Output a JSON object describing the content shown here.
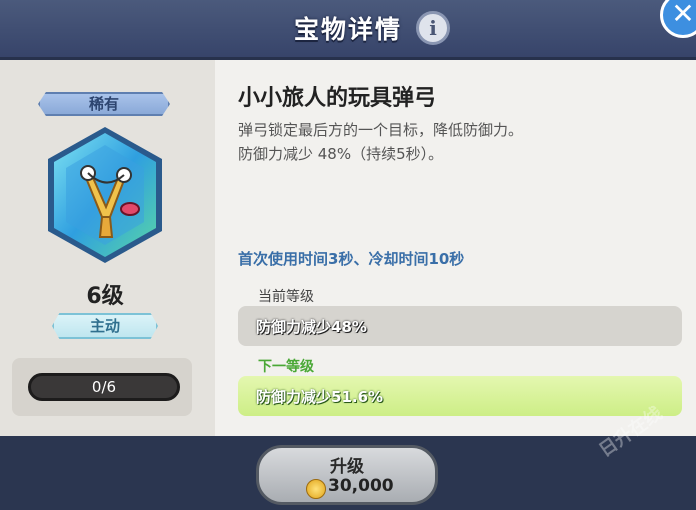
{
  "header": {
    "title": "宝物详情",
    "info_icon": "info-icon",
    "close_icon": "close-icon",
    "colors": {
      "bar": "#37446a",
      "close": "#3d8fe0"
    }
  },
  "item": {
    "rarity": "稀有",
    "level": "6级",
    "type": "主动",
    "progress": "0/6",
    "progress_value": 0,
    "icon": "slingshot-icon",
    "name": "小小旅人的玩具弹弓",
    "description_lines": [
      "弹弓锁定最后方的一个目标，降低防御力。",
      "防御力减少 48%（持续5秒）。"
    ],
    "cooldown": "首次使用时间3秒、冷却时间10秒"
  },
  "current_level": {
    "label": "当前等级",
    "effect": "防御力减少48%"
  },
  "next_level": {
    "label": "下一等级",
    "effect": "防御力减少51.6%"
  },
  "upgrade": {
    "label": "升级",
    "cost": "30,000",
    "coin_icon": "coin-icon"
  },
  "watermark": "日升在线",
  "colors": {
    "next_level": "#4aa836",
    "cooldown": "#3a6fa8"
  }
}
